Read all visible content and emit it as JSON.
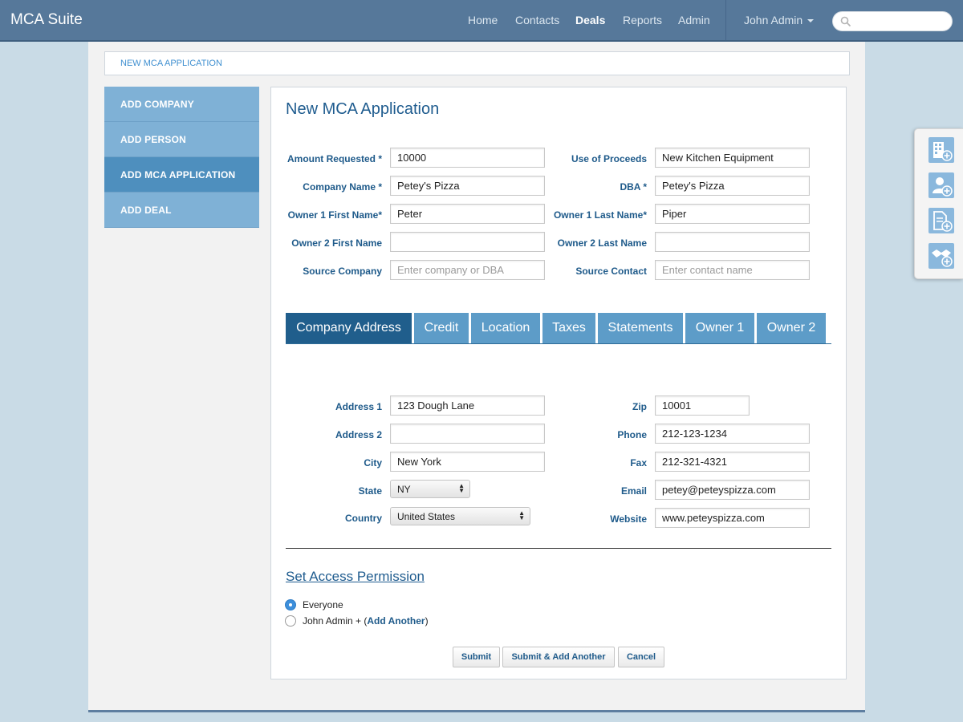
{
  "app": {
    "title": "MCA Suite"
  },
  "nav": {
    "items": [
      {
        "label": "Home"
      },
      {
        "label": "Contacts"
      },
      {
        "label": "Deals"
      },
      {
        "label": "Reports"
      },
      {
        "label": "Admin"
      }
    ],
    "active": "Deals",
    "user": "John Admin",
    "search_placeholder": ""
  },
  "breadcrumb": "NEW MCA APPLICATION",
  "sidebar": {
    "items": [
      {
        "label": "ADD COMPANY"
      },
      {
        "label": "ADD PERSON"
      },
      {
        "label": "ADD MCA APPLICATION"
      },
      {
        "label": "ADD DEAL"
      }
    ],
    "active": "ADD MCA APPLICATION"
  },
  "form": {
    "title": "New MCA Application",
    "amount_requested": {
      "label": "Amount Requested *",
      "value": "10000"
    },
    "use_of_proceeds": {
      "label": "Use of Proceeds",
      "value": "New Kitchen Equipment"
    },
    "company_name": {
      "label": "Company Name *",
      "value": "Petey's Pizza"
    },
    "dba": {
      "label": "DBA *",
      "value": "Petey's Pizza"
    },
    "owner1_first": {
      "label": "Owner 1 First Name*",
      "value": "Peter"
    },
    "owner1_last": {
      "label": "Owner 1 Last Name*",
      "value": "Piper"
    },
    "owner2_first": {
      "label": "Owner 2 First Name",
      "value": ""
    },
    "owner2_last": {
      "label": "Owner 2 Last Name",
      "value": ""
    },
    "source_company": {
      "label": "Source Company",
      "value": "",
      "placeholder": "Enter company or DBA"
    },
    "source_contact": {
      "label": "Source Contact",
      "value": "",
      "placeholder": "Enter contact name"
    }
  },
  "tabs": {
    "items": [
      {
        "label": "Company Address"
      },
      {
        "label": "Credit"
      },
      {
        "label": "Location"
      },
      {
        "label": "Taxes"
      },
      {
        "label": "Statements"
      },
      {
        "label": "Owner 1"
      },
      {
        "label": "Owner 2"
      }
    ],
    "active": "Company Address"
  },
  "address": {
    "address1": {
      "label": "Address 1",
      "value": "123 Dough Lane"
    },
    "address2": {
      "label": "Address 2",
      "value": ""
    },
    "city": {
      "label": "City",
      "value": "New York"
    },
    "state": {
      "label": "State",
      "value": "NY"
    },
    "country": {
      "label": "Country",
      "value": "United States"
    },
    "zip": {
      "label": "Zip",
      "value": "10001"
    },
    "phone": {
      "label": "Phone",
      "value": "212-123-1234"
    },
    "fax": {
      "label": "Fax",
      "value": "212-321-4321"
    },
    "email": {
      "label": "Email",
      "value": "petey@peteyspizza.com"
    },
    "website": {
      "label": "Website",
      "value": "www.peteyspizza.com"
    }
  },
  "permission": {
    "title": "Set Access Permission",
    "options": [
      {
        "label": "Everyone",
        "checked": true
      },
      {
        "label_prefix": "John Admin + (",
        "link": "Add Another",
        "label_suffix": ")",
        "checked": false
      }
    ]
  },
  "buttons": {
    "submit": "Submit",
    "submit_add_another": "Submit & Add Another",
    "cancel": "Cancel"
  },
  "quickbar": {
    "icons": [
      "add-company-icon",
      "add-person-icon",
      "add-document-icon",
      "add-deal-icon"
    ]
  },
  "colors": {
    "topbar": "#56789a",
    "sidebar": "#7fb1d6",
    "sidebar_active": "#4e8fbe",
    "tab": "#5d9cc8",
    "tab_active": "#205e8c",
    "label": "#1e5a8a",
    "radio_checked": "#3d8fdb"
  }
}
